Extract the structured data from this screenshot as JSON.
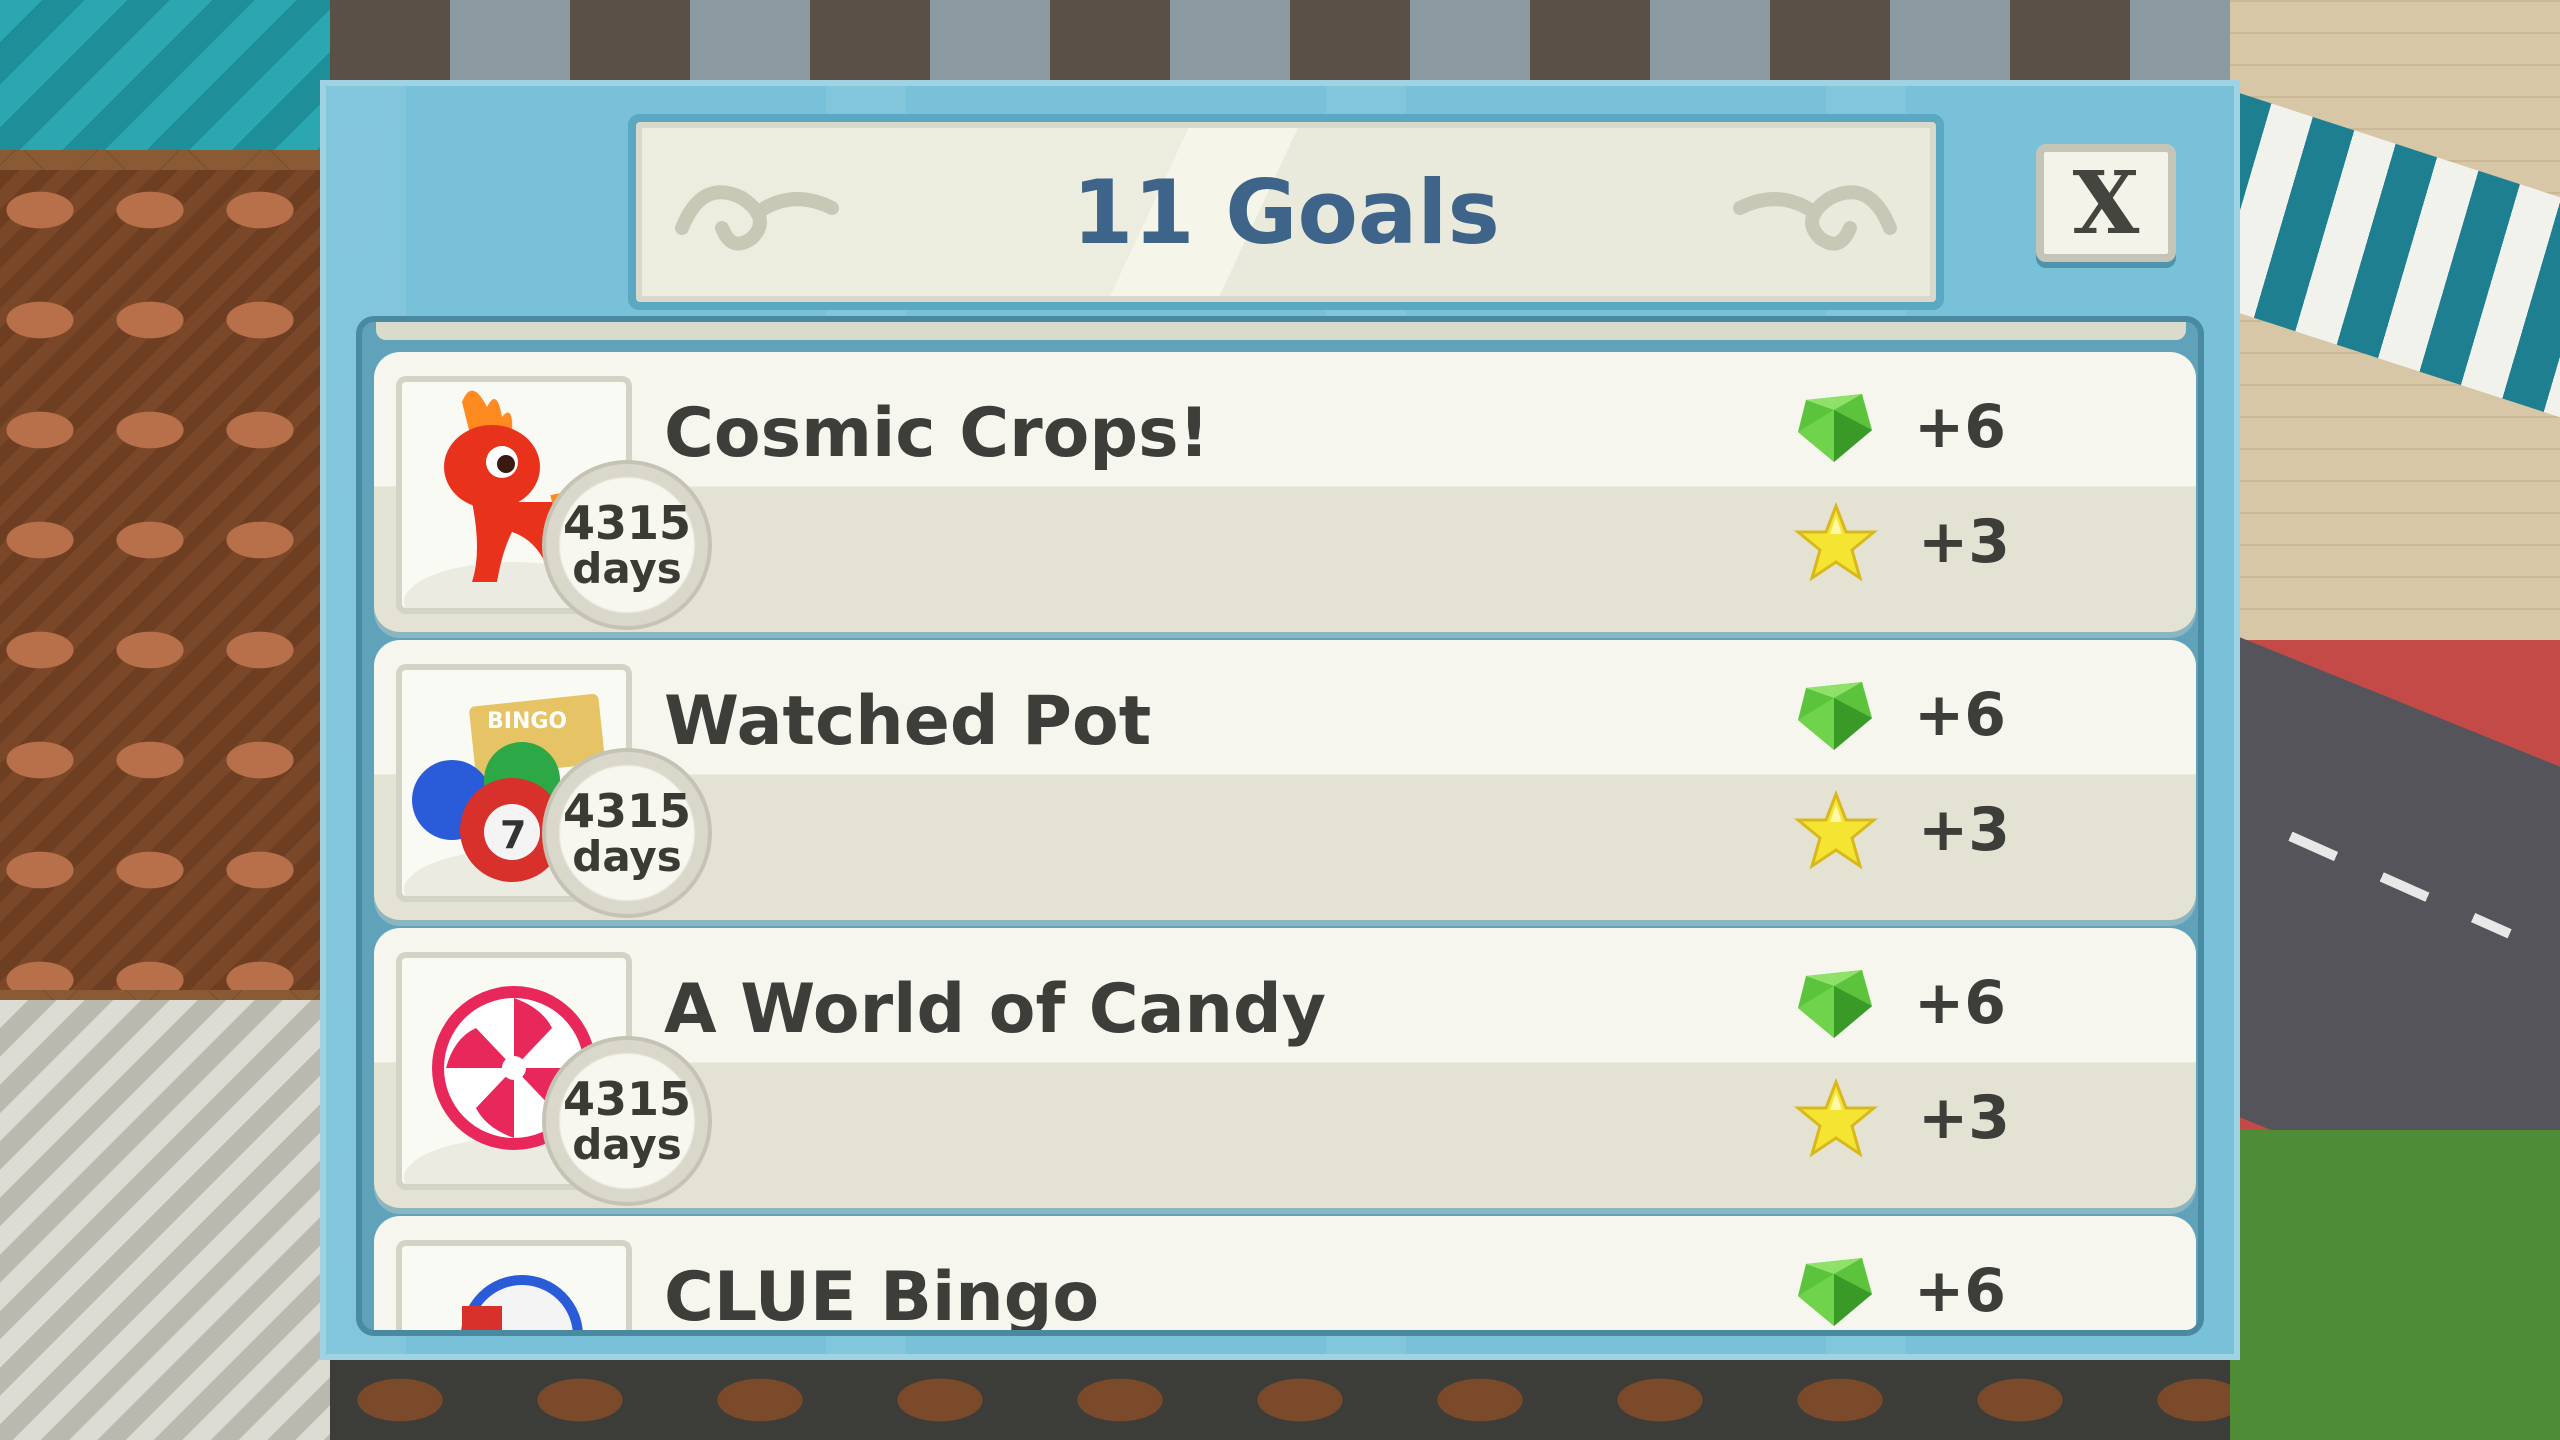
{
  "dialog": {
    "title": "11 Goals",
    "close_label": "X"
  },
  "goals": [
    {
      "title": "Cosmic Crops!",
      "icon": "fire-pony-icon",
      "timer_value": "4315",
      "timer_unit": "days",
      "gem_reward": "+6",
      "star_reward": "+3"
    },
    {
      "title": "Watched Pot",
      "icon": "bingo-balls-icon",
      "timer_value": "4315",
      "timer_unit": "days",
      "gem_reward": "+6",
      "star_reward": "+3"
    },
    {
      "title": "A World of Candy",
      "icon": "peppermint-candy-icon",
      "timer_value": "4315",
      "timer_unit": "days",
      "gem_reward": "+6",
      "star_reward": "+3"
    },
    {
      "title": "CLUE Bingo",
      "icon": "bingo-card-icon",
      "gem_reward": "+6"
    }
  ],
  "colors": {
    "dialog_bg": "#78c1d8",
    "title_text": "#3e6489",
    "gem": "#5cc43c",
    "star": "#f3e532"
  }
}
